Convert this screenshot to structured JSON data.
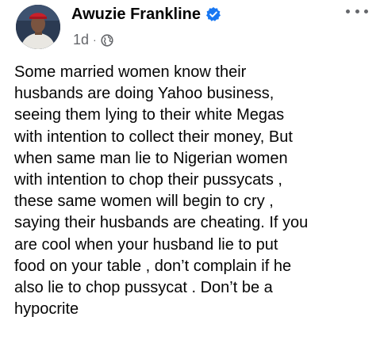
{
  "post": {
    "author": {
      "name": "Awuzie Frankline",
      "verified_icon": "verified-badge-icon",
      "avatar_icon": "profile-photo"
    },
    "meta": {
      "time": "1d",
      "separator": "·",
      "audience_icon": "globe-icon"
    },
    "more_icon": "more-options-icon",
    "text": "Some married women know their\nhusbands are doing Yahoo business,\nseeing them lying to their white Megas\nwith intention to collect their money, But\nwhen same man lie to Nigerian women\nwith intention to chop their pussycats ,\nthese same women will begin to cry ,\nsaying their husbands are cheating. If you\nare cool when your husband lie to put\nfood on your table , don’t complain if he\nalso lie to chop pussycat . Don’t be a\nhypocrite"
  },
  "colors": {
    "text_primary": "#050505",
    "text_secondary": "#65676b",
    "verified_blue": "#1877f2"
  }
}
